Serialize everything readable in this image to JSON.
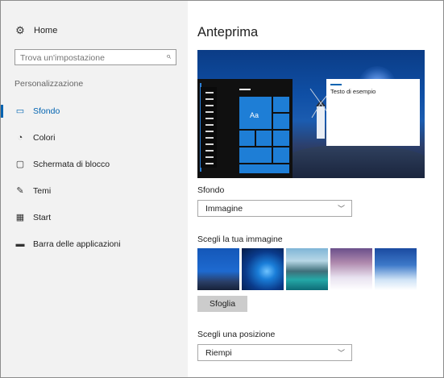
{
  "sidebar": {
    "home_label": "Home",
    "home_icon": "gear-icon",
    "search_placeholder": "Trova un'impostazione",
    "section_title": "Personalizzazione",
    "items": [
      {
        "label": "Sfondo",
        "icon": "picture-icon",
        "active": true
      },
      {
        "label": "Colori",
        "icon": "palette-icon",
        "active": false
      },
      {
        "label": "Schermata di blocco",
        "icon": "lockscreen-icon",
        "active": false
      },
      {
        "label": "Temi",
        "icon": "brush-icon",
        "active": false
      },
      {
        "label": "Start",
        "icon": "start-icon",
        "active": false
      },
      {
        "label": "Barra delle applicazioni",
        "icon": "taskbar-icon",
        "active": false
      }
    ]
  },
  "main": {
    "title": "Anteprima",
    "preview": {
      "tile_label": "Aa",
      "window_text": "Testo di esempio"
    },
    "background_label": "Sfondo",
    "background_value": "Immagine",
    "choose_image_label": "Scegli la tua immagine",
    "browse_label": "Sfoglia",
    "position_label": "Scegli una posizione",
    "position_value": "Riempi"
  },
  "colors": {
    "accent": "#0063b1",
    "sidebar_bg": "#f2f2f2",
    "tile_blue": "#1e7ed6"
  }
}
